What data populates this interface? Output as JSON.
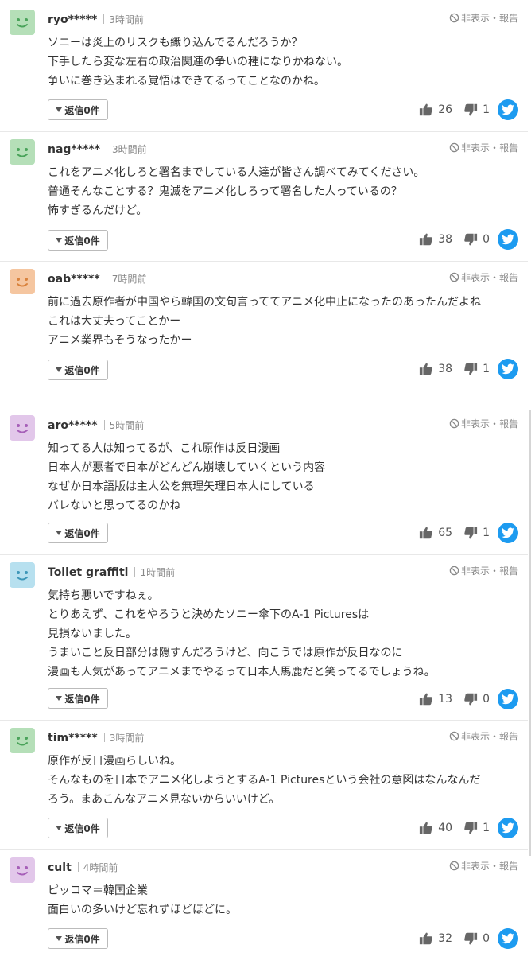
{
  "icons": {
    "hide": "circle-slash-icon",
    "reply": "caret-down-icon",
    "like": "thumbs-up-icon",
    "dislike": "thumbs-down-icon",
    "share": "twitter-icon"
  },
  "colors": {
    "avatar_green": "#b5dfb8",
    "avatar_orange": "#f5c6a0",
    "avatar_purple": "#e2c7ea",
    "avatar_blue": "#b7e0ef",
    "twitter": "#1d9bf0"
  },
  "comments": [
    {
      "avatar_color": "#b5dfb8",
      "face_color": "#4aa35a",
      "user": "ryo*****",
      "time": "3時間前",
      "hide_label": "非表示・報告",
      "text": "ソニーは炎上のリスクも織り込んでるんだろうか？\n下手したら変な左右の政治関連の争いの種になりかねない。\n争いに巻き込まれる覚悟はできてるってことなのかね。",
      "reply_label": "返信0件",
      "likes": "26",
      "dislikes": "1"
    },
    {
      "avatar_color": "#b5dfb8",
      "face_color": "#4aa35a",
      "user": "nag*****",
      "time": "3時間前",
      "hide_label": "非表示・報告",
      "text": "これをアニメ化しろと署名までしている人達が皆さん調べてみてください。\n普通そんなことする？鬼滅をアニメ化しろって署名した人っているの？\n怖すぎるんだけど。",
      "reply_label": "返信0件",
      "likes": "38",
      "dislikes": "0"
    },
    {
      "avatar_color": "#f5c6a0",
      "face_color": "#d9823c",
      "user": "oab*****",
      "time": "7時間前",
      "hide_label": "非表示・報告",
      "text": "前に過去原作者が中国やら韓国の文句言っててアニメ化中止になったのあったんだよね\nこれは大丈夫ってことかー\nアニメ業界もそうなったかー",
      "reply_label": "返信0件",
      "likes": "38",
      "dislikes": "1"
    },
    {
      "avatar_color": "#e2c7ea",
      "face_color": "#a65fb8",
      "user": "aro*****",
      "time": "5時間前",
      "hide_label": "非表示・報告",
      "text": "知ってる人は知ってるが、これ原作は反日漫画\n日本人が悪者で日本がどんどん崩壊していくという内容\nなぜか日本語版は主人公を無理矢理日本人にしている\nバレないと思ってるのかね",
      "reply_label": "返信0件",
      "likes": "65",
      "dislikes": "1"
    },
    {
      "avatar_color": "#b7e0ef",
      "face_color": "#3e97b8",
      "user": "Toilet graffiti",
      "time": "1時間前",
      "hide_label": "非表示・報告",
      "text": "気持ち悪いですねぇ。\nとりあえず、これをやろうと決めたソニー傘下のA-1 Picturesは\n見損ないました。\nうまいこと反日部分は隠すんだろうけど、向こうでは原作が反日なのに\n漫画も人気があってアニメまでやるって日本人馬鹿だと笑ってるでしょうね。",
      "reply_label": "返信0件",
      "likes": "13",
      "dislikes": "0"
    },
    {
      "avatar_color": "#b5dfb8",
      "face_color": "#4aa35a",
      "user": "tim*****",
      "time": "3時間前",
      "hide_label": "非表示・報告",
      "text": "原作が反日漫画らしいね。\nそんなものを日本でアニメ化しようとするA-1 Picturesという会社の意図はなんなんだ\nろう。まあこんなアニメ見ないからいいけど。",
      "reply_label": "返信0件",
      "likes": "40",
      "dislikes": "1"
    },
    {
      "avatar_color": "#e2c7ea",
      "face_color": "#a65fb8",
      "user": "cult",
      "time": "4時間前",
      "hide_label": "非表示・報告",
      "text": "ピッコマ＝韓国企業\n面白いの多いけど忘れずほどほどに。",
      "reply_label": "返信0件",
      "likes": "32",
      "dislikes": "0"
    }
  ]
}
